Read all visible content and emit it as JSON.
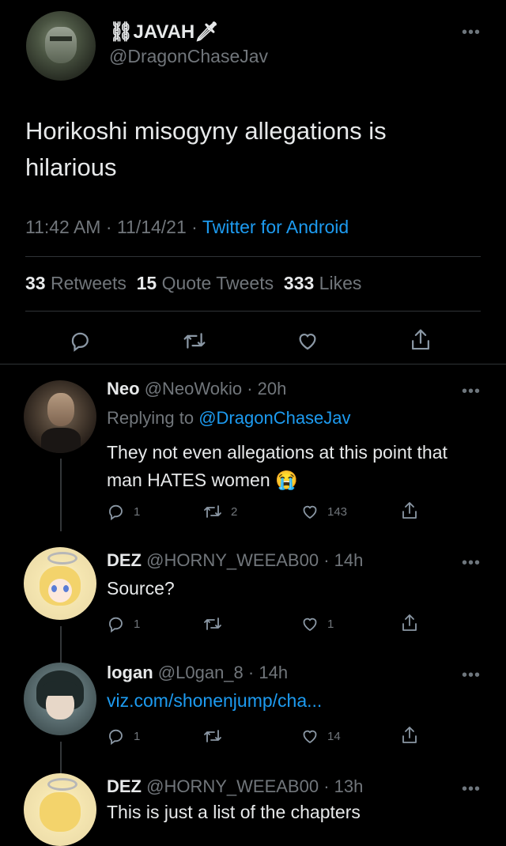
{
  "main_tweet": {
    "display_name": "⛓JAVAH🗡",
    "handle": "@DragonChaseJav",
    "text": "Horikoshi misogyny allegations is hilarious",
    "time": "11:42 AM",
    "date": "11/14/21",
    "source": "Twitter for Android",
    "separator": "·",
    "stats": {
      "retweets_count": "33",
      "retweets_label": "Retweets",
      "quotes_count": "15",
      "quotes_label": "Quote Tweets",
      "likes_count": "333",
      "likes_label": "Likes"
    }
  },
  "replies": [
    {
      "name": "Neo",
      "handle": "@NeoWokio",
      "time": "· 20h",
      "replying_label": "Replying to",
      "replying_handle": "@DragonChaseJav",
      "text": "They not even allegations at this point that man HATES women 😭",
      "reply_count": "1",
      "retweet_count": "2",
      "like_count": "143"
    },
    {
      "name": "DEZ",
      "handle": "@HORNY_WEEAB00",
      "time": "· 14h",
      "text": "Source?",
      "reply_count": "1",
      "retweet_count": "",
      "like_count": "1"
    },
    {
      "name": "logan",
      "handle": "@L0gan_8",
      "time": "· 14h",
      "link": "viz.com/shonenjump/cha...",
      "reply_count": "1",
      "retweet_count": "",
      "like_count": "14"
    },
    {
      "name": "DEZ",
      "handle": "@HORNY_WEEAB00",
      "time": "· 13h",
      "text": "This is just a list of the chapters"
    }
  ],
  "colors": {
    "background": "#000000",
    "text": "#e7e9ea",
    "muted": "#71767b",
    "link": "#1d9bf0",
    "divider": "#2f3336"
  },
  "icons": [
    "more-icon",
    "reply-icon",
    "retweet-icon",
    "like-icon",
    "share-icon"
  ]
}
